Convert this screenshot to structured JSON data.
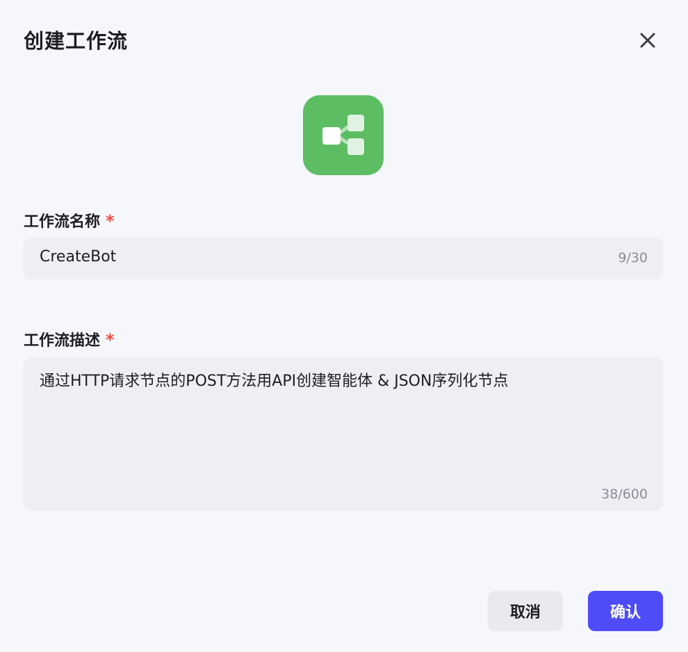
{
  "dialog": {
    "title": "创建工作流",
    "close_icon": "close-icon"
  },
  "icon": {
    "name": "workflow-icon",
    "color": "#5dbd63"
  },
  "name_field": {
    "label": "工作流名称",
    "required_mark": "*",
    "value": "CreateBot",
    "counter": "9/30"
  },
  "desc_field": {
    "label": "工作流描述",
    "required_mark": "*",
    "value": "通过HTTP请求节点的POST方法用API创建智能体 & JSON序列化节点",
    "counter": "38/600"
  },
  "footer": {
    "cancel_label": "取消",
    "confirm_label": "确认",
    "confirm_color": "#4e4cf7",
    "required_color": "#f04c3e"
  }
}
